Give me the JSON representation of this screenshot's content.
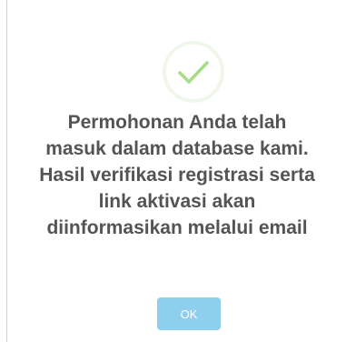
{
  "dialog": {
    "icon": "check-icon",
    "message_lines": [
      "Permohonan Anda telah",
      "masuk dalam database kami.",
      "Hasil verifikasi registrasi serta",
      "link aktivasi akan",
      "diinformasikan melalui email"
    ],
    "ok_label": "OK"
  },
  "colors": {
    "check": "#a5dc86",
    "check_ring": "#eef7e9",
    "text": "#545454",
    "button": "#8fcfee"
  }
}
